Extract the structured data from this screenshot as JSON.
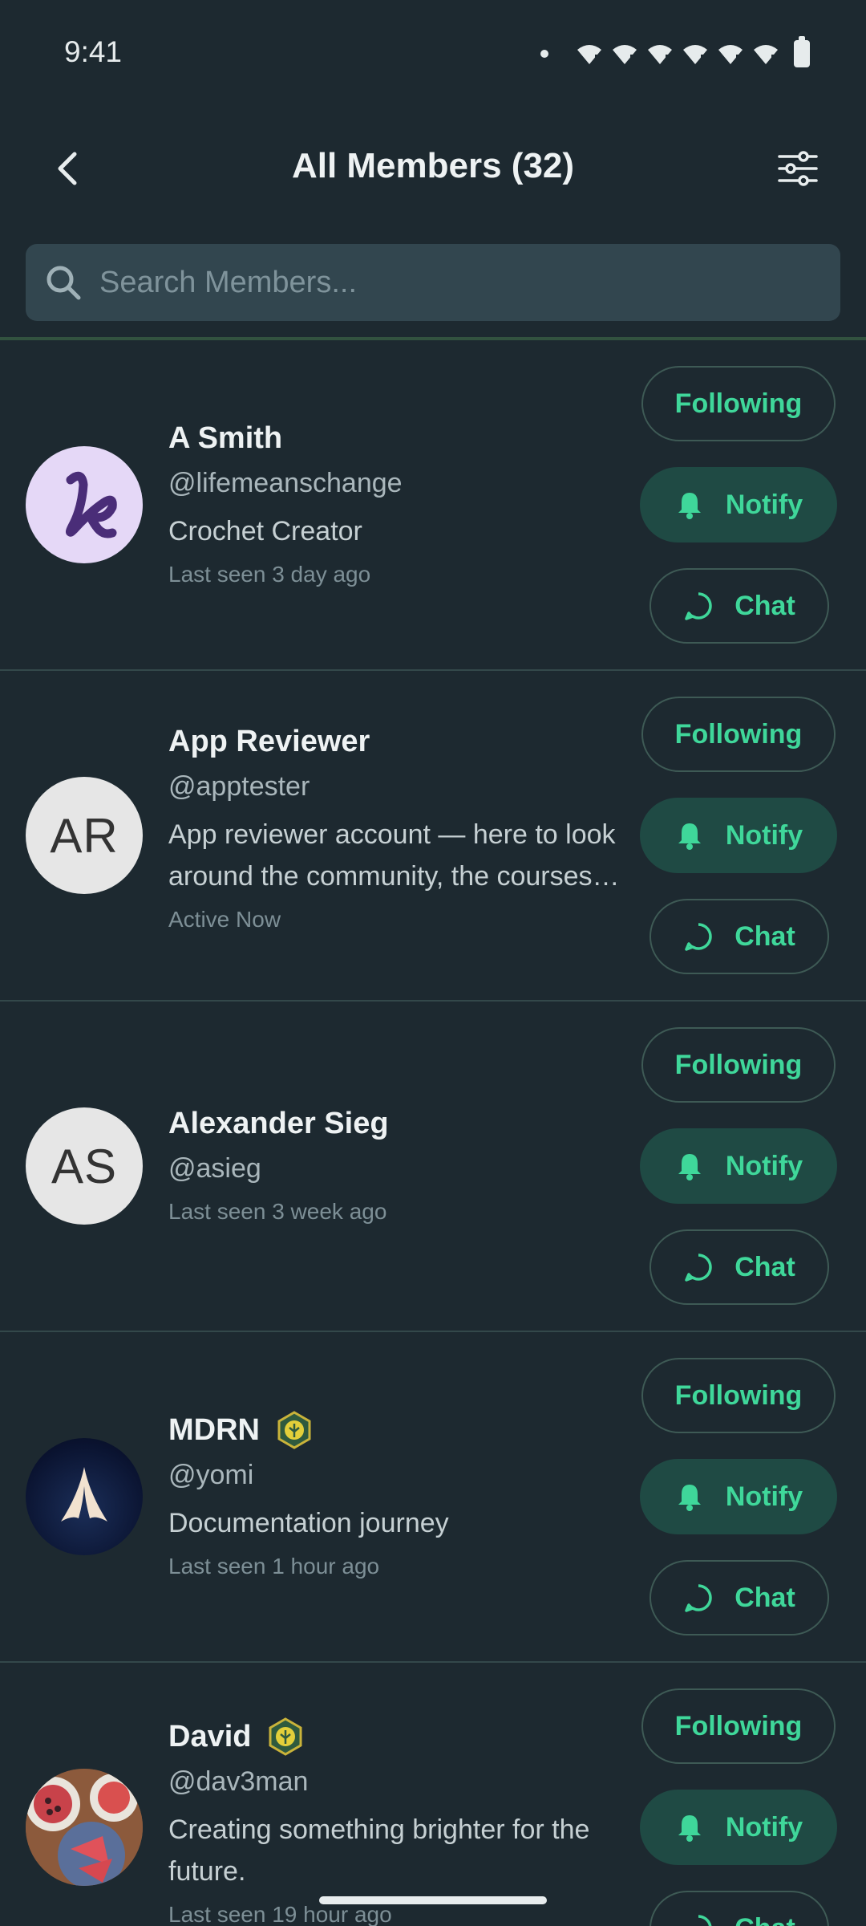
{
  "status_bar": {
    "time": "9:41"
  },
  "header": {
    "title": "All Members (32)"
  },
  "search": {
    "placeholder": "Search Members..."
  },
  "buttons": {
    "following": "Following",
    "notify": "Notify",
    "chat": "Chat"
  },
  "members": [
    {
      "name": "A Smith",
      "handle": "@lifemeanschange",
      "bio": "Crochet Creator",
      "status": "Last seen 3 day ago",
      "avatar": "K"
    },
    {
      "name": "App Reviewer",
      "handle": "@apptester",
      "bio": "App reviewer account — here to look around the community, the courses…",
      "status": "Active Now",
      "avatar": "AR"
    },
    {
      "name": "Alexander Sieg",
      "handle": "@asieg",
      "bio": "",
      "status": "Last seen 3 week ago",
      "avatar": "AS"
    },
    {
      "name": "MDRN",
      "handle": "@yomi",
      "bio": "Documentation journey",
      "status": "Last seen 1 hour ago",
      "avatar": ""
    },
    {
      "name": "David",
      "handle": "@dav3man",
      "bio": "Creating something brighter for the future.",
      "status": "Last seen 19 hour ago",
      "avatar": ""
    }
  ],
  "colors": {
    "background": "#1d2930",
    "accent": "#3fd79a",
    "notify_fill": "#1f4a44",
    "search_bg": "#32464f"
  }
}
